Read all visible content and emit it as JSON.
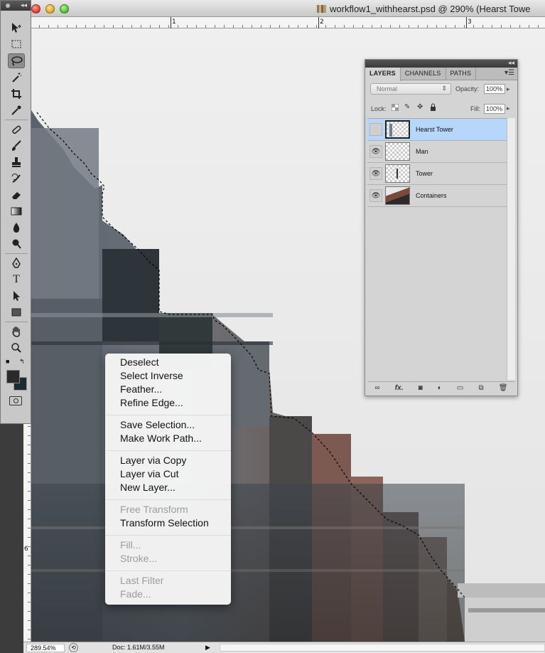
{
  "window": {
    "title": "workflow1_withhearst.psd @ 290% (Hearst Towe"
  },
  "rulers": {
    "top_numbers": [
      "1",
      "2",
      "3"
    ],
    "left_numbers": [
      "6"
    ]
  },
  "toolbox": {
    "tools": [
      "move-tool",
      "marquee-tool",
      "lasso-tool",
      "magic-wand-tool",
      "crop-tool",
      "eyedropper-tool",
      "healing-brush-tool",
      "brush-tool",
      "clone-stamp-tool",
      "history-brush-tool",
      "eraser-tool",
      "gradient-tool",
      "blur-tool",
      "dodge-tool",
      "pen-tool",
      "type-tool",
      "path-selection-tool",
      "rectangle-tool",
      "hand-tool",
      "zoom-tool"
    ],
    "type_tool_glyph": "T",
    "foreground_color": "#2a2a2a",
    "background_color": "#1c2a33"
  },
  "layers_panel": {
    "tabs": [
      "LAYERS",
      "CHANNELS",
      "PATHS"
    ],
    "active_tab": "LAYERS",
    "blend_mode": "Normal",
    "opacity_label": "Opacity:",
    "opacity_value": "100%",
    "lock_label": "Lock:",
    "fill_label": "Fill:",
    "fill_value": "100%",
    "layers": [
      {
        "name": "Hearst Tower",
        "visible": false,
        "selected": true
      },
      {
        "name": "Man",
        "visible": true,
        "selected": false
      },
      {
        "name": "Tower",
        "visible": true,
        "selected": false
      },
      {
        "name": "Containers",
        "visible": true,
        "selected": false
      }
    ],
    "footer_icons": [
      "link-icon",
      "fx-icon",
      "mask-icon",
      "adjustment-icon",
      "folder-icon",
      "new-layer-icon",
      "trash-icon"
    ],
    "fx_label": "fx."
  },
  "context_menu": {
    "items": [
      {
        "label": "Deselect",
        "enabled": true
      },
      {
        "label": "Select Inverse",
        "enabled": true
      },
      {
        "label": "Feather...",
        "enabled": true
      },
      {
        "label": "Refine Edge...",
        "enabled": true
      },
      {
        "label": "Save Selection...",
        "enabled": true
      },
      {
        "label": "Make Work Path...",
        "enabled": true
      },
      {
        "label": "Layer via Copy",
        "enabled": true
      },
      {
        "label": "Layer via Cut",
        "enabled": true
      },
      {
        "label": "New Layer...",
        "enabled": true
      },
      {
        "label": "Free Transform",
        "enabled": false
      },
      {
        "label": "Transform Selection",
        "enabled": true
      },
      {
        "label": "Fill...",
        "enabled": false
      },
      {
        "label": "Stroke...",
        "enabled": false
      },
      {
        "label": "Last Filter",
        "enabled": false
      },
      {
        "label": "Fade...",
        "enabled": false
      }
    ]
  },
  "status_bar": {
    "zoom": "289.54%",
    "doc_size": "Doc: 1.61M/3.55M"
  }
}
